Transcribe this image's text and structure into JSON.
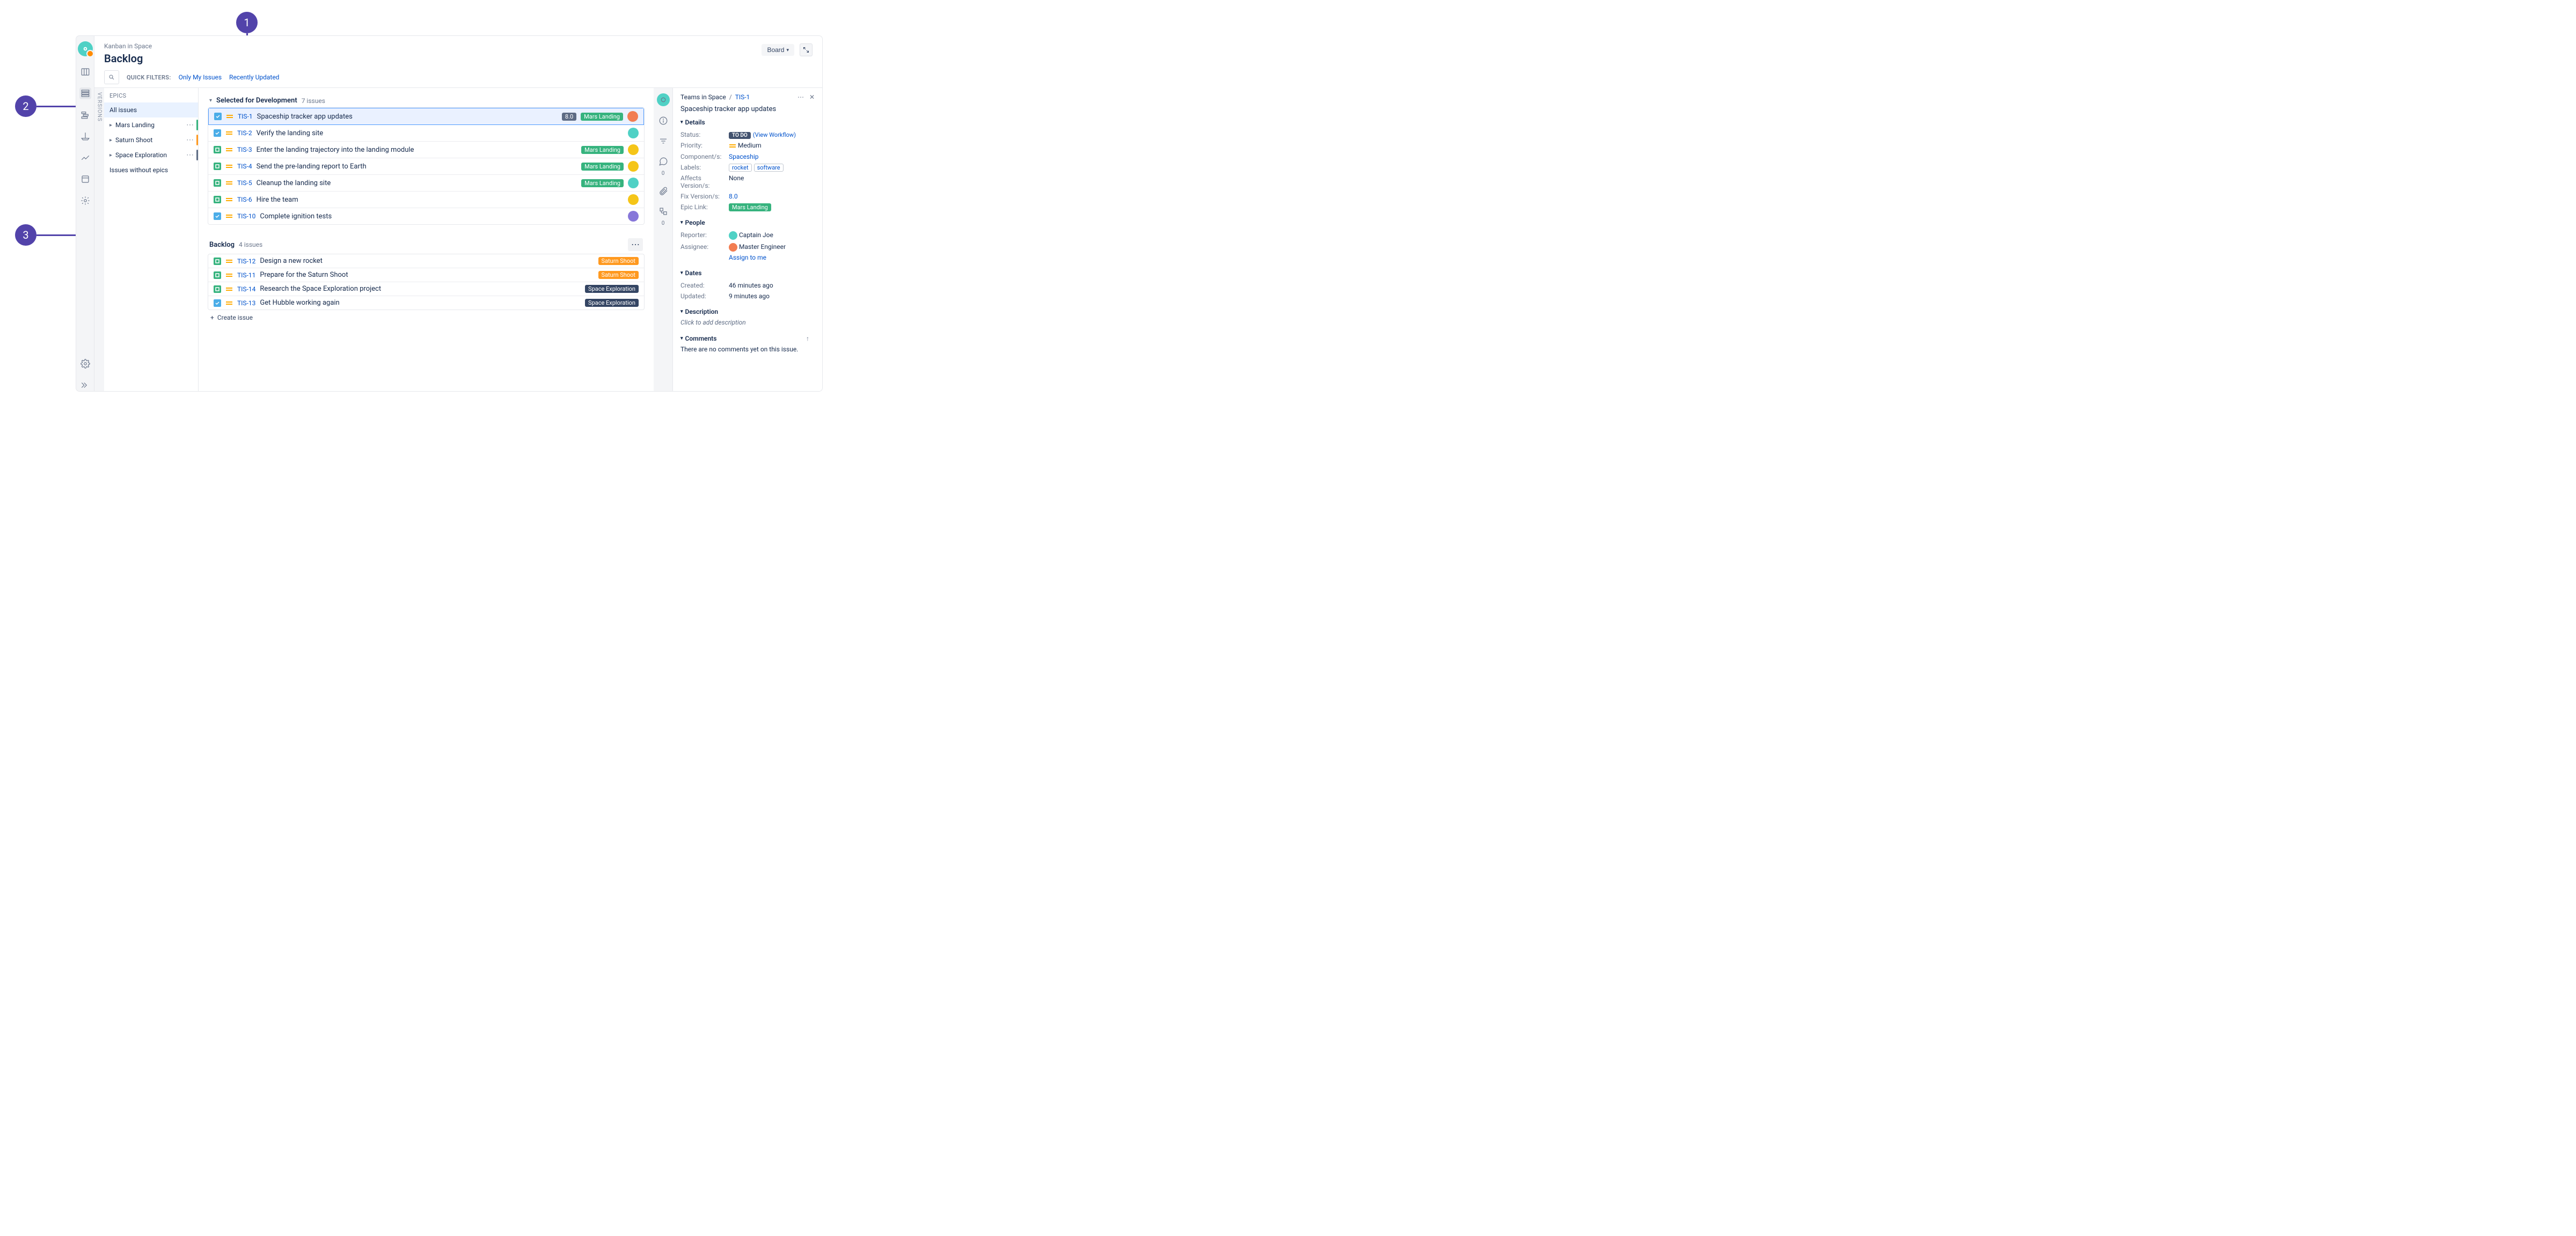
{
  "callouts": [
    "1",
    "2",
    "3"
  ],
  "header": {
    "breadcrumb": "Kanban in Space",
    "title": "Backlog",
    "board_btn": "Board",
    "quick_filters_label": "QUICK FILTERS:",
    "filters": [
      "Only My Issues",
      "Recently Updated"
    ]
  },
  "epics": {
    "header": "EPICS",
    "versions_tab": "VERSIONS",
    "all_label": "All issues",
    "items": [
      {
        "name": "Mars Landing",
        "color": "#36b37e"
      },
      {
        "name": "Saturn Shoot",
        "color": "#ff991f"
      },
      {
        "name": "Space Exploration",
        "color": "#5e6c84"
      }
    ],
    "without": "Issues without epics"
  },
  "sections": [
    {
      "title": "Selected for Development",
      "count": "7 issues",
      "issues": [
        {
          "type": "task",
          "key": "TIS-1",
          "summary": "Spaceship tracker app updates",
          "version": "8.0",
          "epic": "Mars Landing",
          "epic_color": "green",
          "avatar": "#f27d52",
          "selected": true
        },
        {
          "type": "task",
          "key": "TIS-2",
          "summary": "Verify the landing site",
          "avatar": "#4fd1c5"
        },
        {
          "type": "story",
          "key": "TIS-3",
          "summary": "Enter the landing trajectory into the landing module",
          "epic": "Mars Landing",
          "epic_color": "green",
          "avatar": "#f5c518"
        },
        {
          "type": "story",
          "key": "TIS-4",
          "summary": "Send the pre-landing report to Earth",
          "epic": "Mars Landing",
          "epic_color": "green",
          "avatar": "#f5c518"
        },
        {
          "type": "story",
          "key": "TIS-5",
          "summary": "Cleanup the landing site",
          "epic": "Mars Landing",
          "epic_color": "green",
          "avatar": "#4fd1c5"
        },
        {
          "type": "story",
          "key": "TIS-6",
          "summary": "Hire the team",
          "avatar": "#f5c518"
        },
        {
          "type": "task",
          "key": "TIS-10",
          "summary": "Complete ignition tests",
          "avatar": "#8777d9"
        }
      ]
    },
    {
      "title": "Backlog",
      "count": "4 issues",
      "show_more": true,
      "issues": [
        {
          "type": "story",
          "key": "TIS-12",
          "summary": "Design a new rocket",
          "epic": "Saturn Shoot",
          "epic_color": "orange"
        },
        {
          "type": "story",
          "key": "TIS-11",
          "summary": "Prepare for the Saturn Shoot",
          "epic": "Saturn Shoot",
          "epic_color": "orange"
        },
        {
          "type": "story",
          "key": "TIS-14",
          "summary": "Research the Space Exploration project",
          "epic": "Space Exploration",
          "epic_color": "dark"
        },
        {
          "type": "task",
          "key": "TIS-13",
          "summary": "Get Hubble working again",
          "epic": "Space Exploration",
          "epic_color": "dark"
        }
      ],
      "create": "Create issue"
    }
  ],
  "detail": {
    "project": "Teams in Space",
    "key": "TIS-1",
    "title": "Spaceship tracker app updates",
    "sections": {
      "details": "Details",
      "people": "People",
      "dates": "Dates",
      "description": "Description",
      "comments": "Comments"
    },
    "status": {
      "label": "Status:",
      "value": "TO DO",
      "workflow": "(View Workflow)"
    },
    "priority": {
      "label": "Priority:",
      "value": "Medium"
    },
    "components": {
      "label": "Component/s:",
      "value": "Spaceship"
    },
    "labels": {
      "label": "Labels:",
      "values": [
        "rocket",
        "software"
      ]
    },
    "affects": {
      "label": "Affects Version/s:",
      "value": "None"
    },
    "fix": {
      "label": "Fix Version/s:",
      "value": "8.0"
    },
    "epic_link": {
      "label": "Epic Link:",
      "value": "Mars Landing"
    },
    "reporter": {
      "label": "Reporter:",
      "value": "Captain Joe",
      "avatar": "#4fd1c5"
    },
    "assignee": {
      "label": "Assignee:",
      "value": "Master Engineer",
      "avatar": "#f27d52",
      "assign_link": "Assign to me"
    },
    "created": {
      "label": "Created:",
      "value": "46 minutes ago"
    },
    "updated": {
      "label": "Updated:",
      "value": "9 minutes ago"
    },
    "description_placeholder": "Click to add description",
    "no_comments": "There are no comments yet on this issue.",
    "comment_count": "0",
    "attach_count": "0"
  }
}
